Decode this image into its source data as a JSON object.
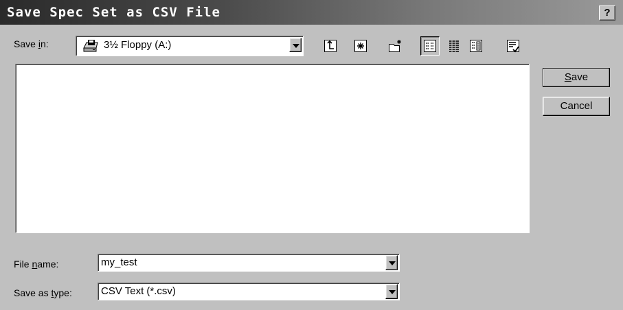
{
  "window": {
    "title": "Save Spec Set as CSV File",
    "help_label": "?"
  },
  "save_in": {
    "label_pre": "Save ",
    "label_acc": "i",
    "label_post": "n:",
    "value": "3½ Floppy (A:)",
    "icon": "floppy-drive-icon"
  },
  "toolbar": {
    "icons": [
      "up-one-level-icon",
      "desktop-icon",
      "new-folder-icon",
      "list-view-icon",
      "details-view-icon",
      "properties-view-icon",
      "commands-icon"
    ]
  },
  "buttons": {
    "save_acc": "S",
    "save_rest": "ave",
    "cancel": "Cancel"
  },
  "file_name": {
    "label_pre": "File ",
    "label_acc": "n",
    "label_post": "ame:",
    "value": "my_test"
  },
  "save_as_type": {
    "label_pre": "Save as ",
    "label_acc": "t",
    "label_post": "ype:",
    "value": "CSV Text (*.csv)"
  }
}
